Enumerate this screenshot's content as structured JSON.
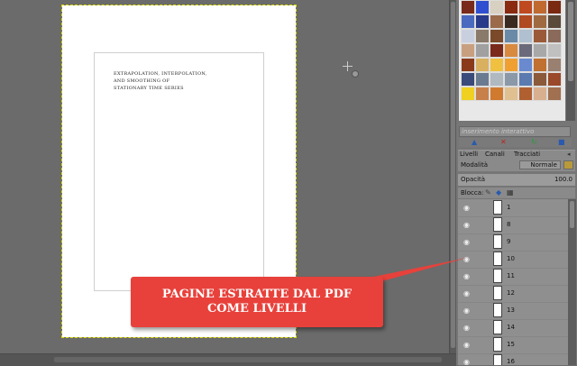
{
  "document": {
    "title_lines": [
      "EXTRAPOLATION, INTERPOLATION,",
      "AND SMOOTHING OF",
      "STATIONARY TIME SERIES"
    ]
  },
  "patterns": {
    "tag_placeholder": "inserimento interattivo",
    "colors": [
      "#7a2a1a",
      "#2f4fd0",
      "#d8d0c0",
      "#8a2a10",
      "#c04a20",
      "#c06a30",
      "#7a2a10",
      "#4a6ac0",
      "#2a3a8a",
      "#9a6a4a",
      "#3a2a20",
      "#b04a20",
      "#a06a40",
      "#5a4a3a",
      "#c8d0e0",
      "#8a7a6a",
      "#7a4a2a",
      "#6a8aa8",
      "#b0c0d0",
      "#9a5a3a",
      "#8a6a5a",
      "#c8a080",
      "#a0a0a0",
      "#7a2a1a",
      "#d88a40",
      "#6a6a7a",
      "#a8a8a8",
      "#c0c0c0",
      "#8a3a1a",
      "#d8b060",
      "#f0c040",
      "#f0a030",
      "#6a8ad0",
      "#c07030",
      "#9a8070",
      "#3a4a7a",
      "#6a7a90",
      "#b0b8c0",
      "#8a98a8",
      "#5a7ab0",
      "#8a5a3a",
      "#9a4a2a",
      "#f0d020",
      "#c8804a",
      "#d07a30",
      "#e0c090",
      "#b06030",
      "#d8b090",
      "#a07050"
    ]
  },
  "layers_panel": {
    "tabs": [
      "Livelli",
      "Canali",
      "Tracciati"
    ],
    "mode_label": "Modalità",
    "mode_value": "Normale",
    "opacity_label": "Opacità",
    "opacity_value": "100.0",
    "lock_label": "Blocca:",
    "layers": [
      "1",
      "8",
      "9",
      "10",
      "11",
      "12",
      "13",
      "14",
      "15",
      "16"
    ]
  },
  "callout": {
    "line1": "PAGINE ESTRATTE DAL PDF",
    "line2": "COME LIVELLI",
    "color": "#e8413b"
  }
}
